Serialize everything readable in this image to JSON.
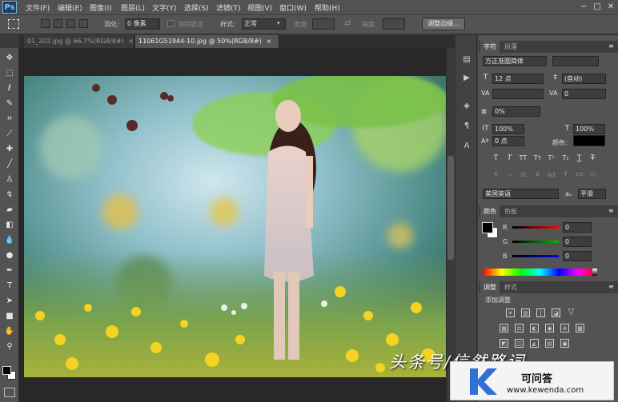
{
  "app": {
    "logo": "Ps"
  },
  "menubar": {
    "items": [
      "文件(F)",
      "编辑(E)",
      "图像(I)",
      "图层(L)",
      "文字(Y)",
      "选择(S)",
      "滤镜(T)",
      "视图(V)",
      "窗口(W)",
      "帮助(H)"
    ],
    "window_controls": [
      "−",
      "□",
      "✕"
    ]
  },
  "options": {
    "feather_label": "羽化:",
    "feather_value": "0 像素",
    "antialias_label": "消除锯齿",
    "style_label": "样式:",
    "style_value": "正常",
    "width_label": "宽度:",
    "height_label": "高度:",
    "swap_icon": "⇄",
    "refine_edge": "调整边缘..."
  },
  "tabs": [
    {
      "label": "01_202.jpg @ 66.7%(RGB/8#)",
      "close": "×"
    },
    {
      "label": "11061G51944-10.jpg @ 50%(RGB/8#)",
      "close": "×"
    }
  ],
  "character_panel": {
    "tabs": [
      "字符",
      "段落"
    ],
    "font_family": "方正准圆简体",
    "font_style": "-",
    "font_size": "12 点",
    "leading": "(自动)",
    "kerning": "",
    "tracking": "0",
    "tsume": "0%",
    "vertical_scale": "100%",
    "horizontal_scale": "100%",
    "baseline_shift": "0 点",
    "color_label": "颜色:",
    "style_buttons": [
      "T",
      "T",
      "TT",
      "Tт",
      "T¹",
      "T₁",
      "T",
      "T"
    ],
    "opentype_buttons": [
      "fi",
      "ℴ",
      "st",
      "A",
      "ad",
      "T",
      "1st",
      "½"
    ],
    "language": "美国英语",
    "aa_label": "aₐ",
    "antialias": "平滑"
  },
  "color_panel": {
    "tabs": [
      "颜色",
      "色板"
    ],
    "channels": [
      {
        "label": "R",
        "value": "0"
      },
      {
        "label": "G",
        "value": "0"
      },
      {
        "label": "B",
        "value": "0"
      }
    ]
  },
  "adjust_panel": {
    "tabs": [
      "调整",
      "样式"
    ],
    "title": "添加调整"
  },
  "overlay": {
    "watermark": "头条号/信然路词",
    "badge_title": "可问答",
    "badge_url": "www.kewenda.com",
    "badge_logo": "K"
  }
}
